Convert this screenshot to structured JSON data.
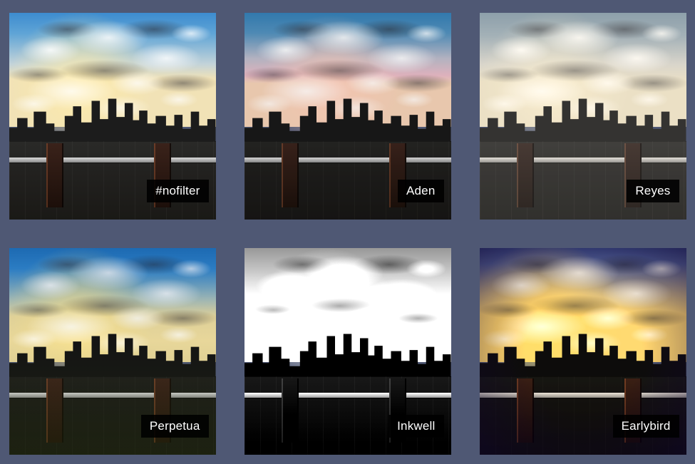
{
  "filters": [
    {
      "id": "nofilter",
      "label": "#nofilter"
    },
    {
      "id": "aden",
      "label": "Aden"
    },
    {
      "id": "reyes",
      "label": "Reyes"
    },
    {
      "id": "perpetua",
      "label": "Perpetua"
    },
    {
      "id": "inkwell",
      "label": "Inkwell"
    },
    {
      "id": "earlybird",
      "label": "Earlybird"
    }
  ]
}
